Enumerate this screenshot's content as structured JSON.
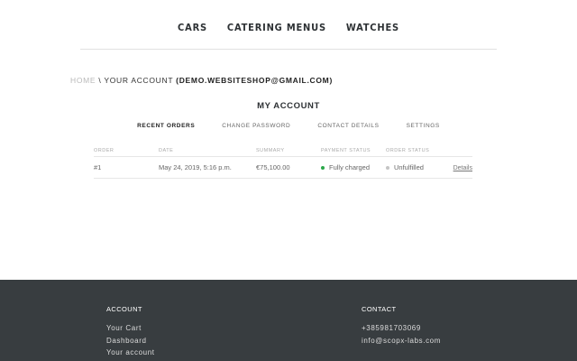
{
  "nav": {
    "items": [
      "CARS",
      "CATERING MENUS",
      "WATCHES"
    ]
  },
  "breadcrumb": {
    "home": "HOME",
    "separator": "\\",
    "current": "YOUR ACCOUNT",
    "email": "(DEMO.WEBSITESHOP@GMAIL.COM)"
  },
  "account": {
    "title": "MY ACCOUNT",
    "tabs": [
      "RECENT ORDERS",
      "CHANGE PASSWORD",
      "CONTACT DETAILS",
      "SETTINGS"
    ],
    "active_tab": "RECENT ORDERS"
  },
  "orders": {
    "columns": [
      "ORDER",
      "DATE",
      "SUMMARY",
      "PAYMENT STATUS",
      "ORDER STATUS",
      ""
    ],
    "rows": [
      {
        "order": "#1",
        "date": "May 24, 2019, 5:16 p.m.",
        "summary": "€75,100.00",
        "payment_status": "Fully charged",
        "order_status": "Unfulfilled",
        "action": "Details"
      }
    ],
    "colors": {
      "paid": "#2ba84a",
      "unfulfilled": "#c4c4c4"
    }
  },
  "footer": {
    "account": {
      "title": "ACCOUNT",
      "links": [
        "Your Cart",
        "Dashboard",
        "Your account"
      ]
    },
    "contact": {
      "title": "CONTACT",
      "phone": "+385981703069",
      "email": "info@scopx-labs.com"
    },
    "background": "#383d40"
  }
}
